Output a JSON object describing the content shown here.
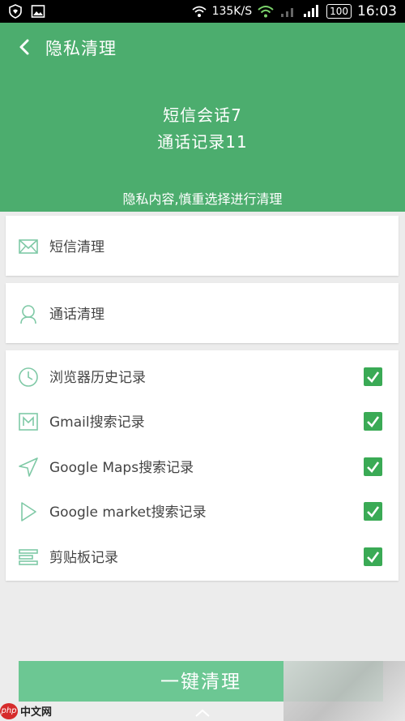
{
  "status_bar": {
    "speed": "135K/S",
    "battery": "100",
    "time": "16:03"
  },
  "header": {
    "title": "隐私清理",
    "sms_count_text": "短信会话7",
    "call_count_text": "通话记录11",
    "warning": "隐私内容,慎重选择进行清理"
  },
  "cards": {
    "sms": {
      "label": "短信清理",
      "icon": "envelope-icon"
    },
    "calls": {
      "label": "通话清理",
      "icon": "person-icon"
    }
  },
  "records": [
    {
      "label": "浏览器历史记录",
      "icon": "clock-icon",
      "checked": true
    },
    {
      "label": "Gmail搜索记录",
      "icon": "gmail-icon",
      "checked": true
    },
    {
      "label": "Google Maps搜索记录",
      "icon": "navigation-icon",
      "checked": true
    },
    {
      "label": "Google market搜索记录",
      "icon": "play-icon",
      "checked": true
    },
    {
      "label": "剪贴板记录",
      "icon": "clipboard-icon",
      "checked": true
    }
  ],
  "actions": {
    "clean_all": "一键清理"
  },
  "watermark": {
    "logo": "php",
    "text": "中文网"
  },
  "colors": {
    "header": "#4cad6e",
    "button": "#6cc793",
    "checkbox": "#3aaa55",
    "icon": "#7fc9a6"
  }
}
